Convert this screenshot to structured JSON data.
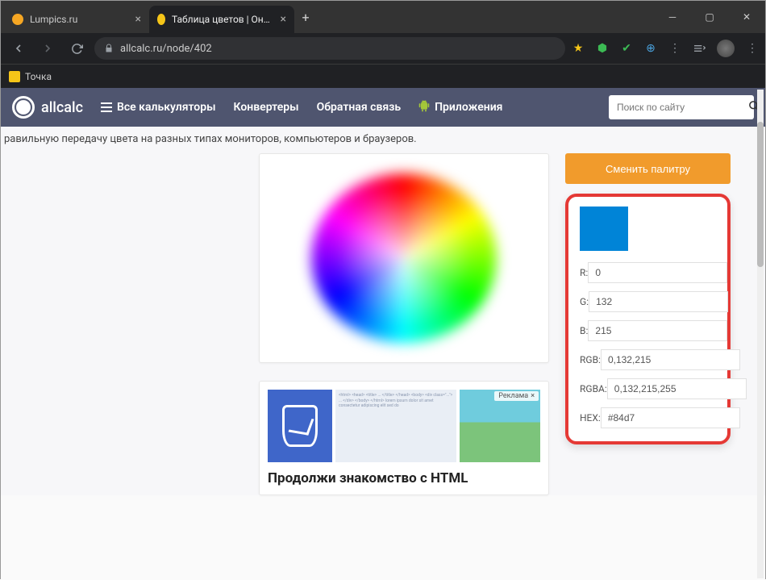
{
  "browser": {
    "tabs": [
      {
        "title": "Lumpics.ru",
        "active": false
      },
      {
        "title": "Таблица цветов | Онлайн кальк",
        "active": true
      }
    ],
    "url": "allcalc.ru/node/402",
    "bookmark": "Точка"
  },
  "site": {
    "brand": "allcalc",
    "menu": {
      "all": "Все калькуляторы",
      "converters": "Конвертеры",
      "feedback": "Обратная связь",
      "apps": "Приложения"
    },
    "search_placeholder": "Поиск по сайту"
  },
  "intro_fragment": "равильную передачу цвета на разных типах мониторов, компьютеров и браузеров.",
  "palette": {
    "change_btn": "Сменить палитру",
    "swatch_color": "#0084d7",
    "labels": {
      "r": "R:",
      "g": "G:",
      "b": "B:",
      "rgb": "RGB:",
      "rgba": "RGBA:",
      "hex": "HEX:"
    },
    "values": {
      "r": "0",
      "g": "132",
      "b": "215",
      "rgb": "0,132,215",
      "rgba": "0,132,215,255",
      "hex": "#84d7"
    }
  },
  "promo": {
    "ad_label": "Реклама",
    "title": "Продолжи знакомство с HTML"
  }
}
